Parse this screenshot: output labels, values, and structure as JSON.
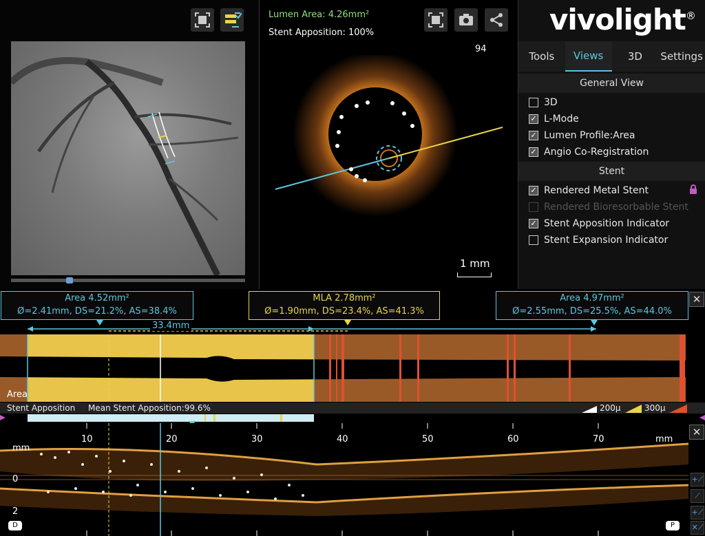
{
  "oct": {
    "lumen_area": "Lumen Area: 4.26mm²",
    "stent_apposition": "Stent Apposition: 100%",
    "frame_number": "94",
    "scale_label": "1 mm"
  },
  "brand": {
    "logo": "vivolight",
    "reg": "®"
  },
  "tabs": [
    "Tools",
    "Views",
    "3D",
    "Settings"
  ],
  "sections": {
    "general_view": "General View",
    "stent": "Stent"
  },
  "general_view_options": [
    {
      "label": "3D",
      "checked": false
    },
    {
      "label": "L-Mode",
      "checked": true
    },
    {
      "label": "Lumen Profile:Area",
      "checked": true
    },
    {
      "label": "Angio Co-Registration",
      "checked": true
    }
  ],
  "stent_options": [
    {
      "label": "Rendered Metal Stent",
      "checked": true
    },
    {
      "label": "Rendered Bioresorbable Stent",
      "checked": false,
      "disabled": true
    },
    {
      "label": "Stent Apposition Indicator",
      "checked": true
    },
    {
      "label": "Stent Expansion Indicator",
      "checked": false
    }
  ],
  "measurements": {
    "left": {
      "line1": "Area 4.52mm²",
      "line2": "Ø=2.41mm, DS=21.2%, AS=38.4%"
    },
    "mla": {
      "line1": "MLA 2.78mm²",
      "line2": "Ø=1.90mm, DS=23.4%, AS=41.3%"
    },
    "right": {
      "line1": "Area 4.97mm²",
      "line2": "Ø=2.55mm, DS=25.5%, AS=44.0%"
    },
    "length": "33.4mm"
  },
  "lmode": {
    "label": "Area"
  },
  "apposition_bar": {
    "title": "Stent Apposition",
    "mean": "Mean Stent Apposition:99.6%",
    "legend_200": "200μ",
    "legend_300": "300μ"
  },
  "long_axis": {
    "ticks": [
      "10",
      "20",
      "30",
      "40",
      "50",
      "60",
      "70"
    ],
    "unit": "mm",
    "y_labels": [
      "mm",
      "0",
      "2"
    ],
    "d_button": "D",
    "p_button": "P"
  },
  "colors": {
    "accent": "#5cc8e0",
    "mla": "#e8d54a",
    "lumen_green": "#8fe07a",
    "stent_fill": "#e8c44a",
    "vessel_fill": "#9a5a28",
    "malapposed": "#e05030"
  }
}
